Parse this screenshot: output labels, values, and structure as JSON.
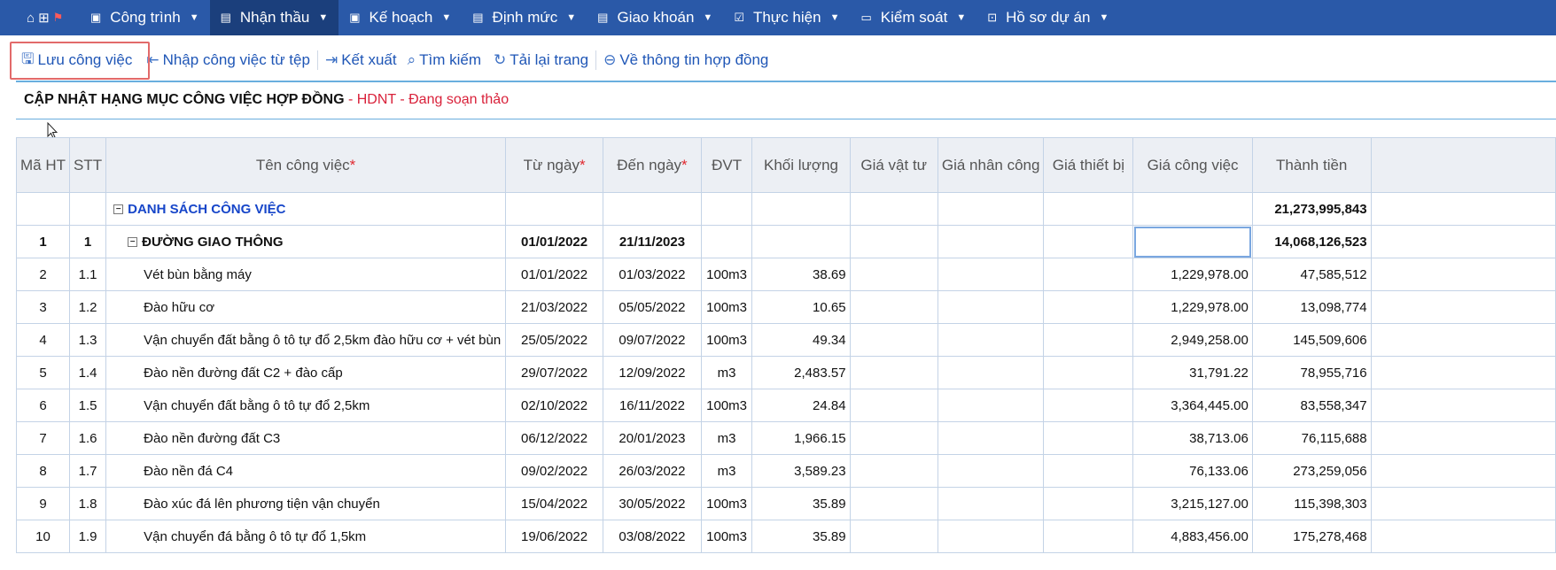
{
  "nav": {
    "icons": [
      "home-icon",
      "grid-icon",
      "flag-icon"
    ],
    "items": [
      {
        "label": "Công trình",
        "icon": "dashboard-icon",
        "active": false
      },
      {
        "label": "Nhận thầu",
        "icon": "document-icon",
        "active": true
      },
      {
        "label": "Kế hoạch",
        "icon": "dashboard-icon",
        "active": false
      },
      {
        "label": "Định mức",
        "icon": "document-icon",
        "active": false
      },
      {
        "label": "Giao khoán",
        "icon": "document-icon",
        "active": false
      },
      {
        "label": "Thực hiện",
        "icon": "checkbox-icon",
        "active": false
      },
      {
        "label": "Kiểm soát",
        "icon": "monitor-icon",
        "active": false
      },
      {
        "label": "Hồ sơ dự án",
        "icon": "briefcase-icon",
        "active": false
      }
    ]
  },
  "toolbar": {
    "save": "Lưu công việc",
    "import": "Nhập công việc từ tệp",
    "export": "Kết xuất",
    "search": "Tìm kiếm",
    "reload": "Tải lại trang",
    "back": "Về thông tin hợp đồng"
  },
  "page": {
    "title": "CẬP NHẬT HẠNG MỤC CÔNG VIỆC HỢP ĐỒNG",
    "status": " - HDNT - Đang soạn thảo"
  },
  "table": {
    "headers": {
      "ma_ht": "Mã HT",
      "stt": "STT",
      "ten": "Tên công việc",
      "tu_ngay": "Từ ngày",
      "den_ngay": "Đến ngày",
      "dvt": "ĐVT",
      "khoi_luong": "Khối lượng",
      "gia_vat_tu": "Giá vật tư",
      "gia_nhan_cong": "Giá nhân công",
      "gia_thiet_bi": "Giá thiết bị",
      "gia_cong_viec": "Giá công việc",
      "thanh_tien": "Thành tiền",
      "required_mark": "*"
    },
    "group": {
      "toggle": "−",
      "name": "DANH SÁCH CÔNG VIỆC",
      "thanh_tien": "21,273,995,843"
    },
    "section": {
      "ma_ht": "1",
      "stt": "1",
      "toggle": "−",
      "name": "ĐƯỜNG GIAO THÔNG",
      "tu_ngay": "01/01/2022",
      "den_ngay": "21/11/2023",
      "thanh_tien": "14,068,126,523"
    },
    "rows": [
      {
        "ma_ht": "2",
        "stt": "1.1",
        "ten": "Vét bùn bằng máy",
        "tu_ngay": "01/01/2022",
        "den_ngay": "01/03/2022",
        "dvt": "100m3",
        "khoi_luong": "38.69",
        "gia_cong_viec": "1,229,978.00",
        "thanh_tien": "47,585,512"
      },
      {
        "ma_ht": "3",
        "stt": "1.2",
        "ten": "Đào hữu cơ",
        "tu_ngay": "21/03/2022",
        "den_ngay": "05/05/2022",
        "dvt": "100m3",
        "khoi_luong": "10.65",
        "gia_cong_viec": "1,229,978.00",
        "thanh_tien": "13,098,774"
      },
      {
        "ma_ht": "4",
        "stt": "1.3",
        "ten": "Vận chuyển đất bằng ô tô tự đổ 2,5km đào hữu cơ + vét bùn",
        "tu_ngay": "25/05/2022",
        "den_ngay": "09/07/2022",
        "dvt": "100m3",
        "khoi_luong": "49.34",
        "gia_cong_viec": "2,949,258.00",
        "thanh_tien": "145,509,606"
      },
      {
        "ma_ht": "5",
        "stt": "1.4",
        "ten": "Đào nền đường đất C2 + đào cấp",
        "tu_ngay": "29/07/2022",
        "den_ngay": "12/09/2022",
        "dvt": "m3",
        "khoi_luong": "2,483.57",
        "gia_cong_viec": "31,791.22",
        "thanh_tien": "78,955,716"
      },
      {
        "ma_ht": "6",
        "stt": "1.5",
        "ten": "Vận chuyển đất bằng ô tô tự đổ 2,5km",
        "tu_ngay": "02/10/2022",
        "den_ngay": "16/11/2022",
        "dvt": "100m3",
        "khoi_luong": "24.84",
        "gia_cong_viec": "3,364,445.00",
        "thanh_tien": "83,558,347"
      },
      {
        "ma_ht": "7",
        "stt": "1.6",
        "ten": "Đào nền đường đất C3",
        "tu_ngay": "06/12/2022",
        "den_ngay": "20/01/2023",
        "dvt": "m3",
        "khoi_luong": "1,966.15",
        "gia_cong_viec": "38,713.06",
        "thanh_tien": "76,115,688"
      },
      {
        "ma_ht": "8",
        "stt": "1.7",
        "ten": "Đào nền đá C4",
        "tu_ngay": "09/02/2022",
        "den_ngay": "26/03/2022",
        "dvt": "m3",
        "khoi_luong": "3,589.23",
        "gia_cong_viec": "76,133.06",
        "thanh_tien": "273,259,056"
      },
      {
        "ma_ht": "9",
        "stt": "1.8",
        "ten": "Đào xúc đá lên phương tiện vận chuyển",
        "tu_ngay": "15/04/2022",
        "den_ngay": "30/05/2022",
        "dvt": "100m3",
        "khoi_luong": "35.89",
        "gia_cong_viec": "3,215,127.00",
        "thanh_tien": "115,398,303"
      },
      {
        "ma_ht": "10",
        "stt": "1.9",
        "ten": "Vận chuyển đá bằng ô tô tự đổ 1,5km",
        "tu_ngay": "19/06/2022",
        "den_ngay": "03/08/2022",
        "dvt": "100m3",
        "khoi_luong": "35.89",
        "gia_cong_viec": "4,883,456.00",
        "thanh_tien": "175,278,468"
      }
    ]
  }
}
